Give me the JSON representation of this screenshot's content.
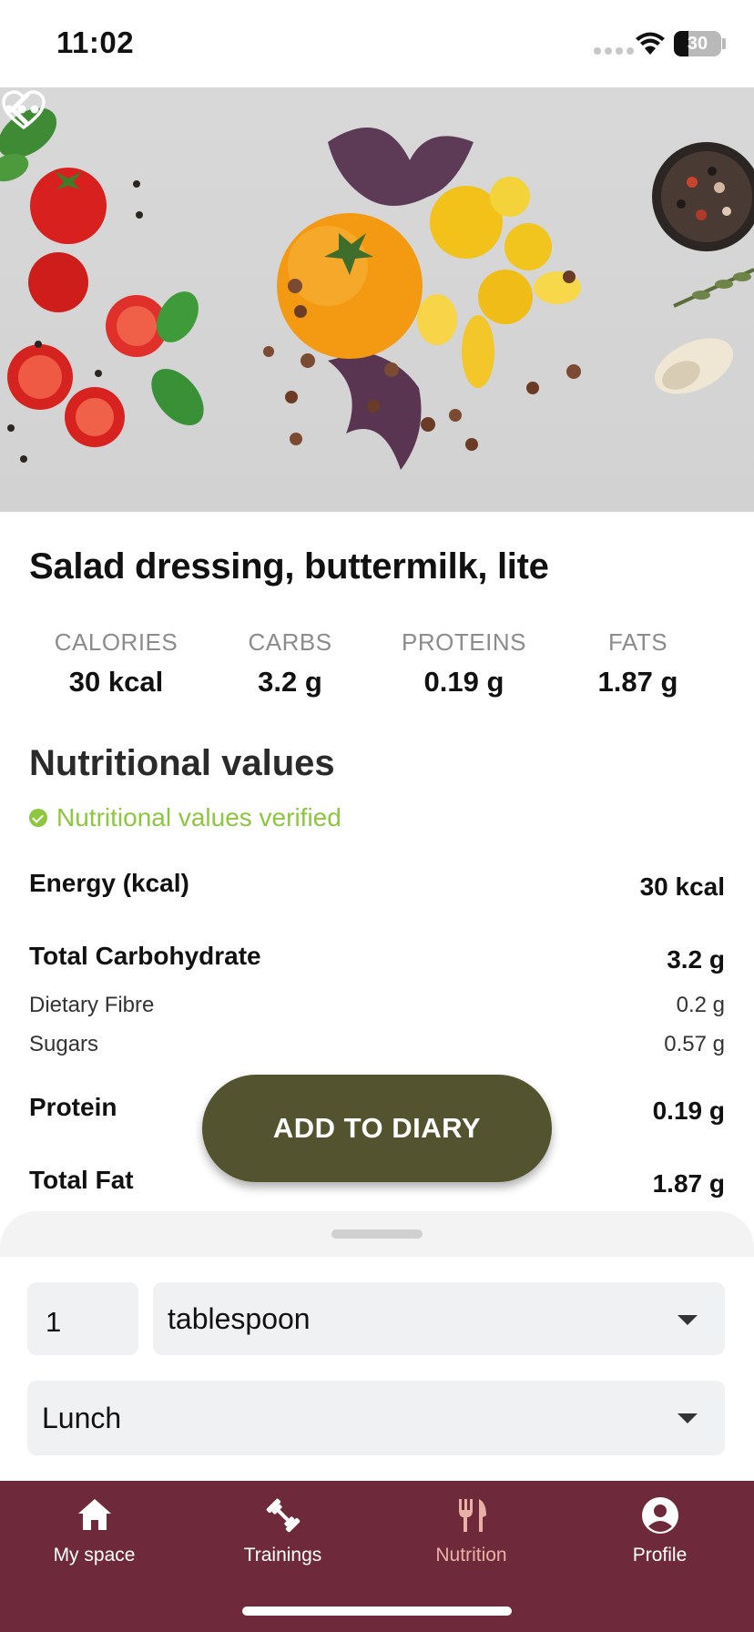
{
  "status_bar": {
    "time": "11:02",
    "battery": "30",
    "battery_level": 0.3
  },
  "hero": {
    "icons": [
      "back-icon",
      "heart-icon",
      "more-icon"
    ],
    "image": "food-ingredients-photo"
  },
  "food": {
    "title": "Salad dressing, buttermilk, lite",
    "macros": [
      {
        "label": "CALORIES",
        "value": "30 kcal"
      },
      {
        "label": "CARBS",
        "value": "3.2 g"
      },
      {
        "label": "PROTEINS",
        "value": "0.19 g"
      },
      {
        "label": "FATS",
        "value": "1.87 g"
      }
    ]
  },
  "nutrition": {
    "title": "Nutritional values",
    "verified": "Nutritional values verified",
    "rows": [
      {
        "label": "Energy (kcal)",
        "value": "30 kcal",
        "kind": "main"
      },
      {
        "label": "Total Carbohydrate",
        "value": "3.2 g",
        "kind": "main"
      },
      {
        "label": "Dietary Fibre",
        "value": "0.2 g",
        "kind": "sub"
      },
      {
        "label": "Sugars",
        "value": "0.57 g",
        "kind": "sub"
      },
      {
        "label": "Protein",
        "value": "0.19 g",
        "kind": "main"
      },
      {
        "label": "Total Fat",
        "value": "1.87 g",
        "kind": "main"
      }
    ]
  },
  "actions": {
    "add_to_diary": "ADD TO DIARY"
  },
  "portion": {
    "quantity": "1",
    "unit": "tablespoon",
    "meal": "Lunch"
  },
  "tabs": [
    {
      "label": "My space",
      "icon": "home-icon"
    },
    {
      "label": "Trainings",
      "icon": "dumbbell-icon"
    },
    {
      "label": "Nutrition",
      "icon": "fork-knife-icon",
      "active": true
    },
    {
      "label": "Profile",
      "icon": "person-icon"
    }
  ],
  "colors": {
    "accent_green": "#8dc63f",
    "button_olive": "#54532f",
    "tabbar": "#6e2a3a",
    "tab_active": "#e8b1a7"
  }
}
